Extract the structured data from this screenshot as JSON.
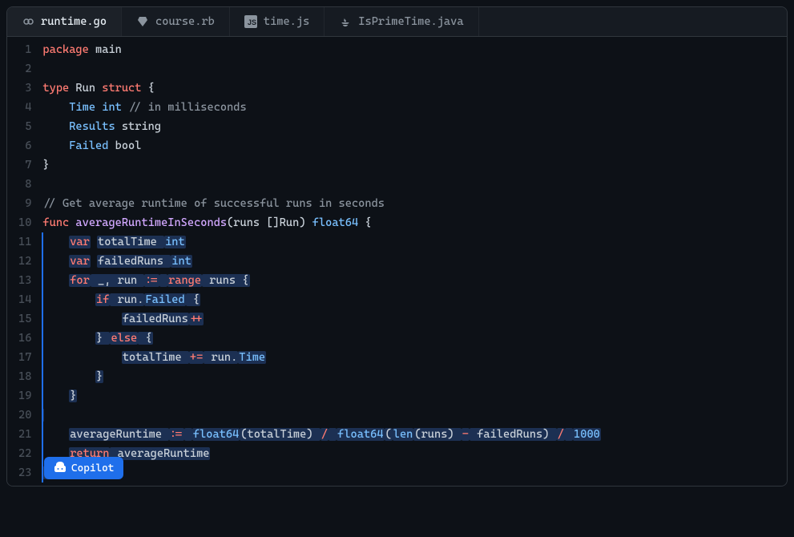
{
  "tabs": [
    {
      "label": "runtime.go",
      "icon": "go",
      "active": true
    },
    {
      "label": "course.rb",
      "icon": "ruby",
      "active": false
    },
    {
      "label": "time.js",
      "icon": "js",
      "active": false
    },
    {
      "label": "IsPrimeTime.java",
      "icon": "java",
      "active": false
    }
  ],
  "copilot_label": "Copilot",
  "code_lines": [
    {
      "n": 1,
      "tokens": [
        [
          "package",
          "tk-kw"
        ],
        [
          " ",
          ""
        ],
        [
          "main",
          "tk-id"
        ]
      ]
    },
    {
      "n": 2,
      "tokens": []
    },
    {
      "n": 3,
      "tokens": [
        [
          "type",
          "tk-kw"
        ],
        [
          " ",
          ""
        ],
        [
          "Run",
          "tk-id"
        ],
        [
          " ",
          ""
        ],
        [
          "struct",
          "tk-kw"
        ],
        [
          " {",
          ""
        ]
      ]
    },
    {
      "n": 4,
      "tokens": [
        [
          "    ",
          ""
        ],
        [
          "Time",
          "tk-field"
        ],
        [
          " ",
          ""
        ],
        [
          "int",
          "tk-builtin"
        ],
        [
          " ",
          ""
        ],
        [
          "// in milliseconds",
          "tk-comment"
        ]
      ]
    },
    {
      "n": 5,
      "tokens": [
        [
          "    ",
          ""
        ],
        [
          "Results",
          "tk-field"
        ],
        [
          " string",
          ""
        ]
      ]
    },
    {
      "n": 6,
      "tokens": [
        [
          "    ",
          ""
        ],
        [
          "Failed",
          "tk-field"
        ],
        [
          " bool",
          ""
        ]
      ]
    },
    {
      "n": 7,
      "tokens": [
        [
          "}",
          ""
        ]
      ]
    },
    {
      "n": 8,
      "tokens": []
    },
    {
      "n": 9,
      "tokens": [
        [
          "// Get average runtime of successful runs in seconds",
          "tk-comment"
        ]
      ]
    },
    {
      "n": 10,
      "tokens": [
        [
          "func",
          "tk-kw"
        ],
        [
          " ",
          ""
        ],
        [
          "averageRuntimeInSeconds",
          "tk-func"
        ],
        [
          "(runs []Run) ",
          ""
        ],
        [
          "float64",
          "tk-builtin"
        ],
        [
          " {",
          ""
        ]
      ]
    }
  ],
  "suggested_lines": [
    {
      "n": 11,
      "tokens": [
        [
          "    ",
          ""
        ],
        [
          "var",
          "tk-kw",
          true
        ],
        [
          " ",
          ""
        ],
        [
          "totalTime ",
          "",
          true
        ],
        [
          "int",
          "tk-builtin",
          true
        ]
      ]
    },
    {
      "n": 12,
      "tokens": [
        [
          "    ",
          ""
        ],
        [
          "var",
          "tk-kw",
          true
        ],
        [
          " ",
          ""
        ],
        [
          "failedRuns ",
          "",
          true
        ],
        [
          "int",
          "tk-builtin",
          true
        ]
      ]
    },
    {
      "n": 13,
      "tokens": [
        [
          "    ",
          ""
        ],
        [
          "for",
          "tk-kw",
          true
        ],
        [
          " _, run ",
          "",
          true
        ],
        [
          ":=",
          "tk-op",
          true
        ],
        [
          " ",
          "",
          true
        ],
        [
          "range",
          "tk-kw",
          true
        ],
        [
          " runs {",
          "",
          true
        ]
      ]
    },
    {
      "n": 14,
      "tokens": [
        [
          "        ",
          ""
        ],
        [
          "if",
          "tk-kw",
          true
        ],
        [
          " run.",
          "",
          true
        ],
        [
          "Failed",
          "tk-field",
          true
        ],
        [
          " {",
          "",
          true
        ]
      ]
    },
    {
      "n": 15,
      "tokens": [
        [
          "            ",
          ""
        ],
        [
          "failedRuns",
          "",
          true
        ],
        [
          "++",
          "tk-op",
          true
        ]
      ]
    },
    {
      "n": 16,
      "tokens": [
        [
          "        ",
          ""
        ],
        [
          "} ",
          "",
          true
        ],
        [
          "else",
          "tk-kw",
          true
        ],
        [
          " {",
          "",
          true
        ]
      ]
    },
    {
      "n": 17,
      "tokens": [
        [
          "            ",
          ""
        ],
        [
          "totalTime ",
          "",
          true
        ],
        [
          "+=",
          "tk-op",
          true
        ],
        [
          " run.",
          "",
          true
        ],
        [
          "Time",
          "tk-field",
          true
        ]
      ]
    },
    {
      "n": 18,
      "tokens": [
        [
          "        ",
          ""
        ],
        [
          "}",
          "",
          true
        ]
      ]
    },
    {
      "n": 19,
      "tokens": [
        [
          "    ",
          ""
        ],
        [
          "}",
          "",
          true
        ]
      ]
    },
    {
      "n": 20,
      "tokens": [
        [
          "",
          "",
          true
        ]
      ]
    },
    {
      "n": 21,
      "tokens": [
        [
          "    ",
          ""
        ],
        [
          "averageRuntime ",
          "",
          true
        ],
        [
          ":=",
          "tk-op",
          true
        ],
        [
          " ",
          "",
          true
        ],
        [
          "float64",
          "tk-builtin",
          true
        ],
        [
          "(totalTime) ",
          "",
          true
        ],
        [
          "/",
          "tk-op",
          true
        ],
        [
          " ",
          "",
          true
        ],
        [
          "float64",
          "tk-builtin",
          true
        ],
        [
          "(",
          "",
          true
        ],
        [
          "len",
          "tk-builtin",
          true
        ],
        [
          "(runs) ",
          "",
          true
        ],
        [
          "-",
          "tk-op",
          true
        ],
        [
          " failedRuns) ",
          "",
          true
        ],
        [
          "/",
          "tk-op",
          true
        ],
        [
          " ",
          "",
          true
        ],
        [
          "1000",
          "tk-num",
          true
        ]
      ]
    },
    {
      "n": 22,
      "tokens": [
        [
          "    ",
          ""
        ],
        [
          "return",
          "tk-kw",
          true
        ],
        [
          " averageRuntime",
          "",
          true
        ]
      ]
    },
    {
      "n": 23,
      "tokens": [
        [
          "}",
          "",
          true
        ]
      ]
    }
  ]
}
